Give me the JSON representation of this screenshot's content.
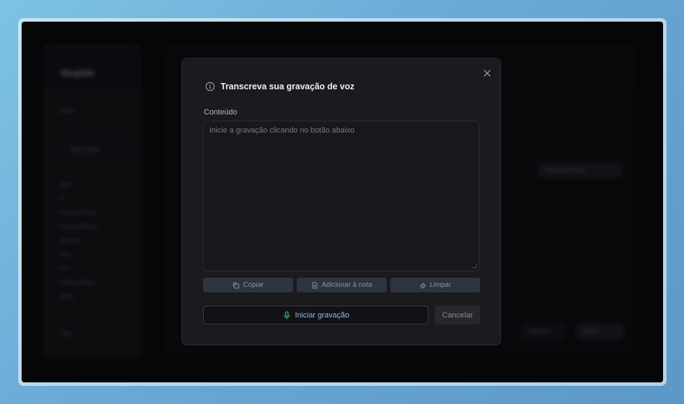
{
  "background_app": {
    "brand": "Illegible",
    "nav_item": "Inicio",
    "new_button": "Nova nota",
    "list_items": [
      "Tags",
      "IA",
      "Procurar notas",
      "Compartilhadas",
      "Arquivos",
      "Itens",
      "Lixo",
      "Configurações",
      "Ajuda"
    ],
    "footer": "Sair",
    "top_right_button": "Transcrever voz",
    "bottom_button_1": "Cancelar",
    "bottom_button_2": "Salvar"
  },
  "modal": {
    "title": "Transcreva sua gravação de voz",
    "info_icon": "info-icon",
    "close_icon": "close-icon",
    "content_label": "Conteúdo",
    "textarea_placeholder": "Inicie a gravação clicando no botão abaixo",
    "textarea_value": "",
    "actions": [
      {
        "label": "Copiar",
        "icon": "copy-icon"
      },
      {
        "label": "Adicionar à nota",
        "icon": "note-add-icon"
      },
      {
        "label": "Limpar",
        "icon": "eraser-icon"
      }
    ],
    "record_button": {
      "label": "Iniciar gravação",
      "icon": "microphone-icon",
      "icon_color": "#3ecf6e"
    },
    "cancel_button": "Cancelar"
  },
  "colors": {
    "page_gradient": "#6aa8d6",
    "modal_bg": "#1a1a1f",
    "action_button_bg": "#2d3440",
    "mic_green": "#3ecf6e"
  }
}
